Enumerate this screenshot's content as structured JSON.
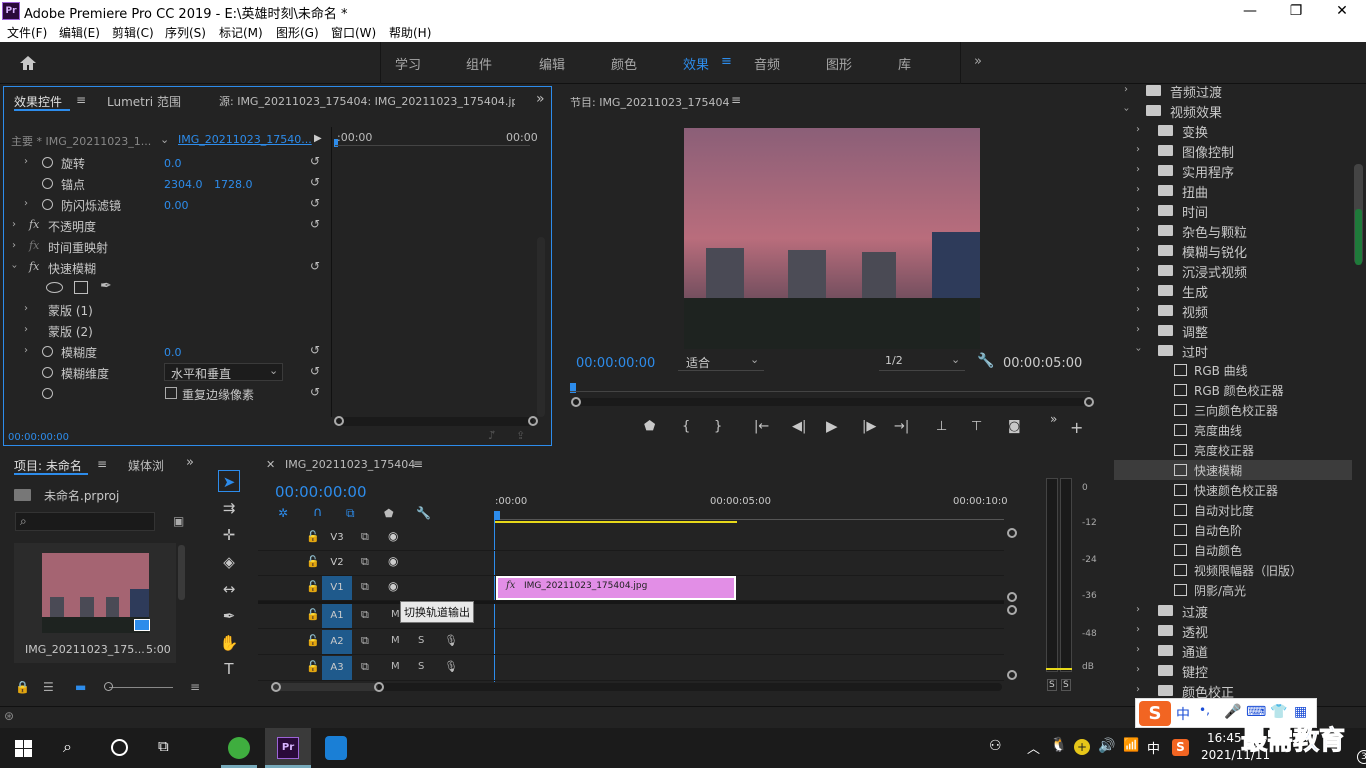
{
  "app": {
    "title": "Adobe Premiere Pro CC 2019 - E:\\英雄时刻\\未命名 *",
    "logo": "Pr"
  },
  "window_controls": {
    "minimize": "—",
    "restore": "❐",
    "close": "✕"
  },
  "menu": [
    "文件(F)",
    "编辑(E)",
    "剪辑(C)",
    "序列(S)",
    "标记(M)",
    "图形(G)",
    "窗口(W)",
    "帮助(H)"
  ],
  "workspaces": [
    "学习",
    "组件",
    "编辑",
    "颜色",
    "效果",
    "音频",
    "图形",
    "库"
  ],
  "workspace_active": "效果",
  "workspace_more": "»",
  "effect_controls": {
    "tab_effect": "效果控件",
    "tab_lumetri": "Lumetri 范围",
    "tab_source": "源: IMG_20211023_175404: IMG_20211023_175404.jpg: 0(",
    "master_label": "主要 * IMG_20211023_1...",
    "clip_label": "IMG_20211023_17540...",
    "time_start": ":00:00",
    "time_end": "00:00",
    "rows": {
      "rotation": {
        "label": "旋转",
        "value": "0.0"
      },
      "anchor": {
        "label": "锚点",
        "value_x": "2304.0",
        "value_y": "1728.0"
      },
      "flicker": {
        "label": "防闪烁滤镜",
        "value": "0.00"
      },
      "opacity": {
        "label": "不透明度"
      },
      "time_remap": {
        "label": "时间重映射"
      },
      "fast_blur": {
        "label": "快速模糊"
      },
      "mask1": {
        "label": "蒙版 (1)"
      },
      "mask2": {
        "label": "蒙版 (2)"
      },
      "blurriness": {
        "label": "模糊度",
        "value": "0.0"
      },
      "blur_dimensions": {
        "label": "模糊维度",
        "value": "水平和垂直"
      },
      "repeat_edge": {
        "label": "重复边缘像素"
      }
    },
    "fx_label": "fx",
    "timecode": "00:00:00:00"
  },
  "program": {
    "title": "节目: IMG_20211023_175404",
    "timecode": "00:00:00:00",
    "fit": "适合",
    "resolution": "1/2",
    "duration": "00:00:05:00"
  },
  "effects_tree": {
    "items": [
      {
        "type": "folder",
        "label": "音频过渡",
        "indent": 0
      },
      {
        "type": "folder-open",
        "label": "视频效果",
        "indent": 0
      },
      {
        "type": "folder",
        "label": "变换",
        "indent": 1
      },
      {
        "type": "folder",
        "label": "图像控制",
        "indent": 1
      },
      {
        "type": "folder",
        "label": "实用程序",
        "indent": 1
      },
      {
        "type": "folder",
        "label": "扭曲",
        "indent": 1
      },
      {
        "type": "folder",
        "label": "时间",
        "indent": 1
      },
      {
        "type": "folder",
        "label": "杂色与颗粒",
        "indent": 1
      },
      {
        "type": "folder",
        "label": "模糊与锐化",
        "indent": 1
      },
      {
        "type": "folder",
        "label": "沉浸式视频",
        "indent": 1
      },
      {
        "type": "folder",
        "label": "生成",
        "indent": 1
      },
      {
        "type": "folder",
        "label": "视频",
        "indent": 1
      },
      {
        "type": "folder",
        "label": "调整",
        "indent": 1
      },
      {
        "type": "folder-open",
        "label": "过时",
        "indent": 1
      },
      {
        "type": "effect",
        "label": "RGB 曲线",
        "indent": 2
      },
      {
        "type": "effect",
        "label": "RGB 颜色校正器",
        "indent": 2
      },
      {
        "type": "effect",
        "label": "三向颜色校正器",
        "indent": 2
      },
      {
        "type": "effect",
        "label": "亮度曲线",
        "indent": 2
      },
      {
        "type": "effect",
        "label": "亮度校正器",
        "indent": 2
      },
      {
        "type": "effect",
        "label": "快速模糊",
        "indent": 2,
        "selected": true
      },
      {
        "type": "effect",
        "label": "快速颜色校正器",
        "indent": 2
      },
      {
        "type": "effect",
        "label": "自动对比度",
        "indent": 2
      },
      {
        "type": "effect",
        "label": "自动色阶",
        "indent": 2
      },
      {
        "type": "effect",
        "label": "自动颜色",
        "indent": 2
      },
      {
        "type": "effect",
        "label": "视频限幅器（旧版）",
        "indent": 2
      },
      {
        "type": "effect",
        "label": "阴影/高光",
        "indent": 2
      },
      {
        "type": "folder",
        "label": "过渡",
        "indent": 1
      },
      {
        "type": "folder",
        "label": "透视",
        "indent": 1
      },
      {
        "type": "folder",
        "label": "通道",
        "indent": 1
      },
      {
        "type": "folder",
        "label": "键控",
        "indent": 1
      },
      {
        "type": "folder",
        "label": "颜色校正",
        "indent": 1
      }
    ]
  },
  "project": {
    "tab_project": "项目: 未命名",
    "tab_media": "媒体浏",
    "tab_more": "»",
    "file": "未命名.prproj",
    "clip_name": "IMG_20211023_175...",
    "clip_duration": "5:00"
  },
  "timeline": {
    "tab": "IMG_20211023_175404",
    "timecode": "00:00:00:00",
    "ruler": [
      ":00:00",
      "00:00:05:00",
      "00:00:10:0"
    ],
    "video_tracks": [
      "V3",
      "V2",
      "V1"
    ],
    "audio_tracks": [
      "A1",
      "A2",
      "A3"
    ],
    "track_m": "M",
    "track_s": "S",
    "clip_label": "IMG_20211023_175404.jpg",
    "clip_fx": "fx",
    "tooltip": "切换轨道输出"
  },
  "meter": {
    "scale": [
      "0",
      "-12",
      "-24",
      "-36",
      "-48",
      "dB"
    ],
    "solo": [
      "S",
      "S"
    ]
  },
  "taskbar": {
    "time": "16:45",
    "date": "2021/11/11",
    "ime": "中",
    "watermark": "最需教育",
    "notification_count": "3"
  },
  "ime_bar": {
    "logo": "S",
    "lang": "中",
    "punct": "•,"
  },
  "colors": {
    "accent": "#2d8ceb",
    "clip": "#e28ee6",
    "yellow": "#e7d91a"
  }
}
